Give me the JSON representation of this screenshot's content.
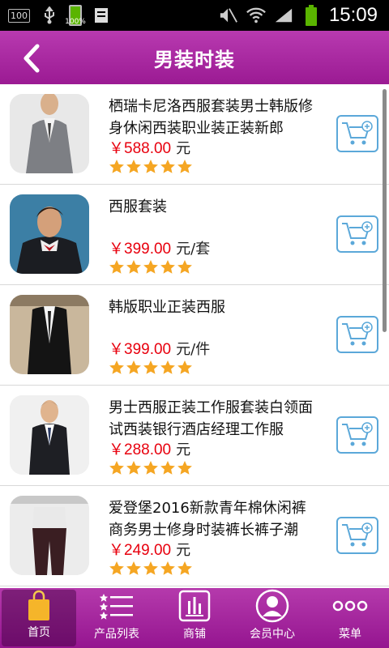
{
  "status_bar": {
    "left_badge": "100",
    "battery_label": "100%",
    "time": "15:09"
  },
  "header": {
    "title": "男装时装",
    "back_icon": "chevron-left-icon"
  },
  "products": [
    {
      "title": "栖瑞卡尼洛西服套装男士韩版修身休闲西装职业装正装新郎",
      "price": "￥588.00",
      "unit": "元",
      "rating": 5
    },
    {
      "title": "西服套装",
      "price": "￥399.00",
      "unit": "元/套",
      "rating": 5
    },
    {
      "title": "韩版职业正装西服",
      "price": "￥399.00",
      "unit": "元/件",
      "rating": 5
    },
    {
      "title": "男士西服正装工作服套装白领面试西装银行酒店经理工作服",
      "price": "￥288.00",
      "unit": "元",
      "rating": 5
    },
    {
      "title": "爱登堡2016新款青年棉休闲裤商务男士修身时装裤长裤子潮",
      "price": "￥249.00",
      "unit": "元",
      "rating": 5
    }
  ],
  "tabbar": {
    "items": [
      {
        "label": "首页",
        "icon": "shopping-bag-icon"
      },
      {
        "label": "产品列表",
        "icon": "list-icon"
      },
      {
        "label": "商铺",
        "icon": "store-icon"
      },
      {
        "label": "会员中心",
        "icon": "user-icon"
      },
      {
        "label": "菜单",
        "icon": "more-icon"
      }
    ],
    "active_index": 0
  },
  "colors": {
    "brand_purple": "#a82aa1",
    "price_red": "#e8000e",
    "star_orange": "#f5a623",
    "cart_blue": "#5ba8d9"
  }
}
